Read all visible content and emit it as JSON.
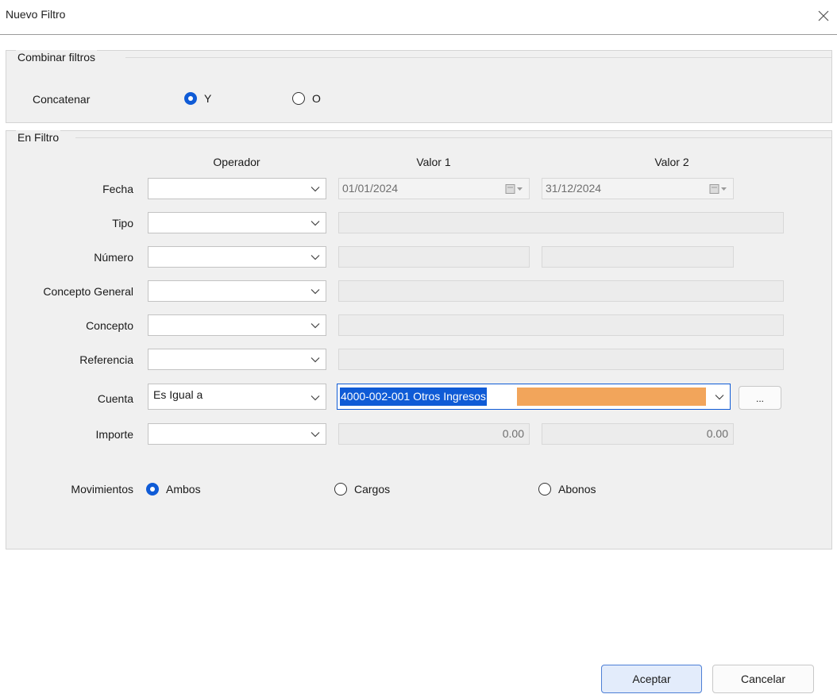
{
  "window": {
    "title": "Nuevo Filtro",
    "close_glyph": "×"
  },
  "combinar": {
    "legend": "Combinar filtros",
    "label": "Concatenar",
    "options": [
      {
        "label": "Y",
        "checked": true
      },
      {
        "label": "O",
        "checked": false
      }
    ]
  },
  "en_filtro": {
    "legend": "En Filtro",
    "headers": {
      "operador": "Operador",
      "valor1": "Valor 1",
      "valor2": "Valor 2"
    },
    "rows": {
      "fecha": {
        "label": "Fecha",
        "operator": "",
        "valor1": "01/01/2024",
        "valor2": "31/12/2024"
      },
      "tipo": {
        "label": "Tipo",
        "operator": "",
        "valor1": ""
      },
      "numero": {
        "label": "Número",
        "operator": "",
        "valor1": "",
        "valor2": ""
      },
      "concepto_general": {
        "label": "Concepto General",
        "operator": "",
        "valor1": ""
      },
      "concepto": {
        "label": "Concepto",
        "operator": "",
        "valor1": ""
      },
      "referencia": {
        "label": "Referencia",
        "operator": "",
        "valor1": ""
      },
      "cuenta": {
        "label": "Cuenta",
        "operator": "Es Igual a",
        "valor1": "4000-002-001 Otros Ingresos",
        "browse_label": "..."
      },
      "importe": {
        "label": "Importe",
        "operator": "",
        "valor1": "0.00",
        "valor2": "0.00"
      }
    },
    "movimientos": {
      "label": "Movimientos",
      "options": [
        {
          "label": "Ambos",
          "checked": true
        },
        {
          "label": "Cargos",
          "checked": false
        },
        {
          "label": "Abonos",
          "checked": false
        }
      ]
    }
  },
  "buttons": {
    "accept": "Aceptar",
    "cancel": "Cancelar"
  },
  "colors": {
    "accent": "#0f5bd6",
    "highlight": "#f2a55b",
    "panel": "#f0f0f0"
  }
}
